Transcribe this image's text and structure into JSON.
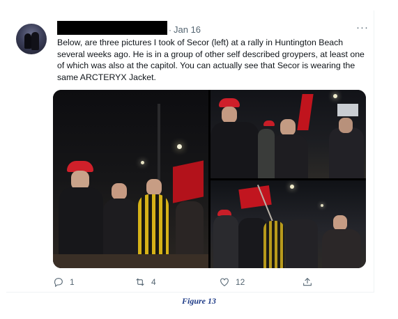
{
  "tweet": {
    "timestamp": "Jan 16",
    "dot": "·",
    "more_label": "···",
    "text": "Below, are three pictures I took of Secor (left) at a rally in Huntington Beach several weeks ago. He is in a group of other self described groypers, at least one of which was also at the capitol. You can actually see that Secor is wearing the same ARCTERYX Jacket.",
    "media": {
      "photos": [
        "photo-rally-group",
        "photo-rally-crowd-close",
        "photo-rally-crowd-flags"
      ]
    },
    "actions": {
      "reply_count": "1",
      "retweet_count": "4",
      "like_count": "12"
    }
  },
  "caption": "Figure 13",
  "colors": {
    "text": "#0f1419",
    "secondary": "#536471",
    "caption": "#1f3c88"
  },
  "icons": [
    "reply-icon",
    "retweet-icon",
    "like-icon",
    "share-icon",
    "more-icon"
  ]
}
